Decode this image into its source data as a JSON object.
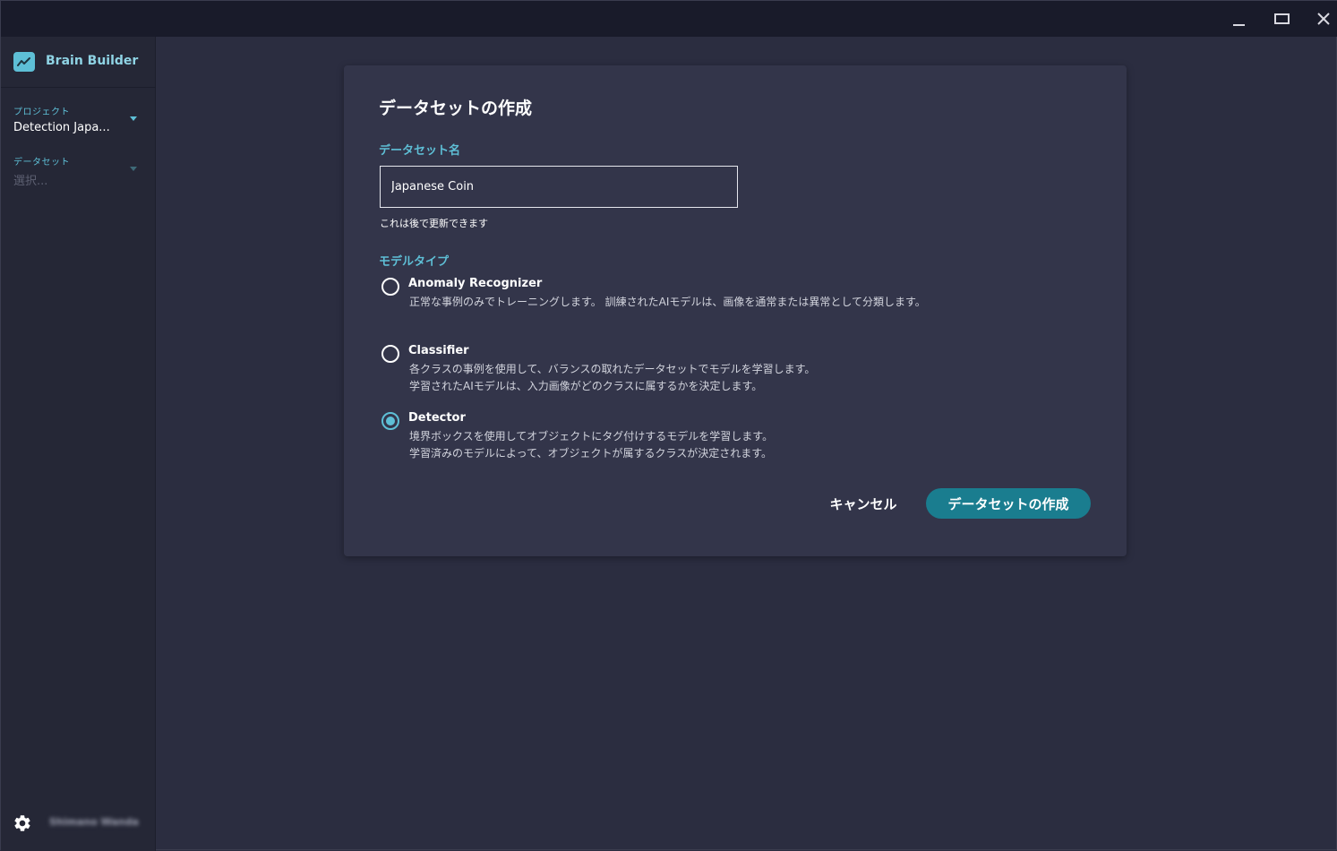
{
  "app": {
    "name": "Brain Builder"
  },
  "window_controls": {
    "minimize": "minimize",
    "maximize": "maximize",
    "close": "close"
  },
  "sidebar": {
    "project_label": "プロジェクト",
    "project_value": "Detection Japa...",
    "dataset_label": "データセット",
    "dataset_value": "選択...",
    "user_name": "Shimano Wanda"
  },
  "dialog": {
    "title": "データセットの作成",
    "name_label": "データセット名",
    "name_value": "Japanese Coin",
    "helper": "これは後で更新できます",
    "model_type_label": "モデルタイプ",
    "options": [
      {
        "title": "Anomaly Recognizer",
        "description": "正常な事例のみでトレーニングします。 訓練されたAIモデルは、画像を通常または異常として分類します。",
        "selected": false
      },
      {
        "title": "Classifier",
        "description_lines": [
          "各クラスの事例を使用して、バランスの取れたデータセットでモデルを学習します。",
          "学習されたAIモデルは、入力画像がどのクラスに属するかを決定します。"
        ],
        "selected": false
      },
      {
        "title": "Detector",
        "description_lines": [
          "境界ボックスを使用してオブジェクトにタグ付けするモデルを学習します。",
          "学習済みのモデルによって、オブジェクトが属するクラスが決定されます。"
        ],
        "selected": true
      }
    ],
    "cancel_label": "キャンセル",
    "create_label": "データセットの作成"
  },
  "colors": {
    "accent": "#5ebfd6",
    "primary_button": "#1a7d8f",
    "background": "#2b2d40",
    "sidebar": "#252736",
    "dialog": "#33354a"
  },
  "icons": {
    "brand": "chart-line-icon",
    "settings": "gear-icon",
    "dropdown": "caret-down-icon"
  }
}
